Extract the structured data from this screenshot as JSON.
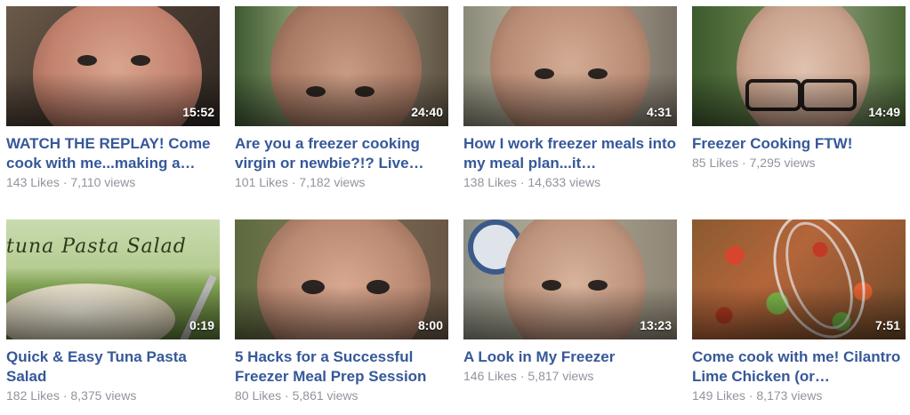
{
  "videos": [
    {
      "title": "WATCH THE REPLAY! Come cook with me...making a…",
      "duration": "15:52",
      "likes": "143 Likes",
      "views": "7,110 views"
    },
    {
      "title": "Are you a freezer cooking virgin or newbie?!? Live…",
      "duration": "24:40",
      "likes": "101 Likes",
      "views": "7,182 views"
    },
    {
      "title": "How I work freezer meals into my meal plan...it…",
      "duration": "4:31",
      "likes": "138 Likes",
      "views": "14,633 views"
    },
    {
      "title": "Freezer Cooking FTW!",
      "duration": "14:49",
      "likes": "85 Likes",
      "views": "7,295 views"
    },
    {
      "title": "Quick & Easy Tuna Pasta Salad",
      "duration": "0:19",
      "likes": "182 Likes",
      "views": "8,375 views",
      "thumb_text": "tuna Pasta Salad"
    },
    {
      "title": "5 Hacks for a Successful Freezer Meal Prep Session",
      "duration": "8:00",
      "likes": "80 Likes",
      "views": "5,861 views"
    },
    {
      "title": "A Look in My Freezer",
      "duration": "13:23",
      "likes": "146 Likes",
      "views": "5,817 views"
    },
    {
      "title": "Come cook with me! Cilantro Lime Chicken (or…",
      "duration": "7:51",
      "likes": "149 Likes",
      "views": "8,173 views"
    }
  ],
  "separator": "·",
  "colors": {
    "title_link": "#365899",
    "meta_text": "#90949c",
    "duration_text": "#ffffff"
  }
}
